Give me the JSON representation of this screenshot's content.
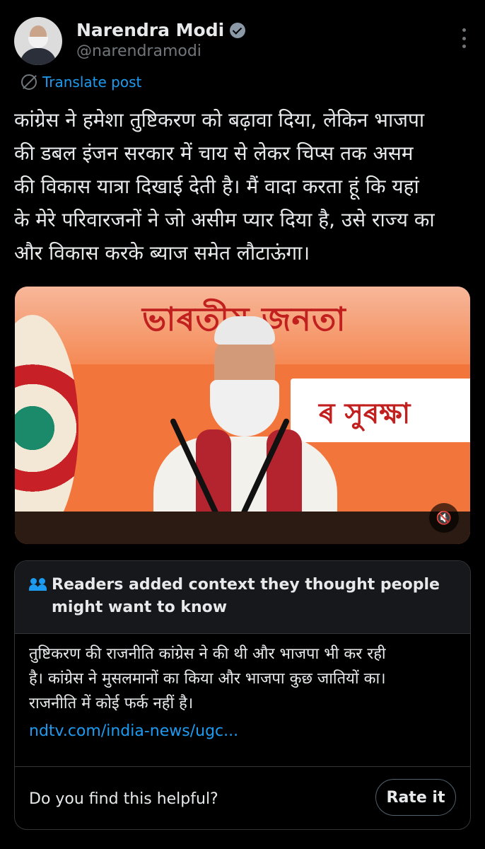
{
  "post": {
    "author_name": "Narendra Modi",
    "author_handle": "@narendramodi",
    "translate_label": "Translate post",
    "text_lines": [
      "कांग्रेस ने हमेशा तुष्टिकरण को बढ़ावा दिया, लेकिन भाजपा",
      "की डबल इंजन सरकार में चाय से लेकर चिप्स तक असम",
      "की विकास यात्रा दिखाई देती है। मैं वादा करता हूं कि यहां",
      "के मेरे परिवारजनों ने जो असीम प्यार दिया है, उसे राज्य का",
      "और विकास करके ब्याज समेत लौटाऊंगा।"
    ]
  },
  "media": {
    "banner_top_text": "ভাৰতীয় জনতা",
    "banner_side_text": "ৰ সুৰক্ষা",
    "mute_icon": "speaker-muted-icon"
  },
  "community_note": {
    "title_line1": "Readers added context they thought people",
    "title_line2": "might want to know",
    "body_lines": [
      "तुष्टिकरण की राजनीति कांग्रेस ने की थी और भाजपा भी कर रही",
      "है। कांग्रेस ने मुसलमानों का किया और भाजपा कुछ जातियों का।",
      "राजनीति में कोई फर्क नहीं है।"
    ],
    "link_text": "ndtv.com/india-news/ugc...",
    "helpful_question": "Do you find this helpful?",
    "rate_button_label": "Rate it"
  },
  "colors": {
    "accent": "#1d9bf0",
    "background": "#000000",
    "text": "#e7e9ea",
    "secondary_text": "#71767b"
  }
}
